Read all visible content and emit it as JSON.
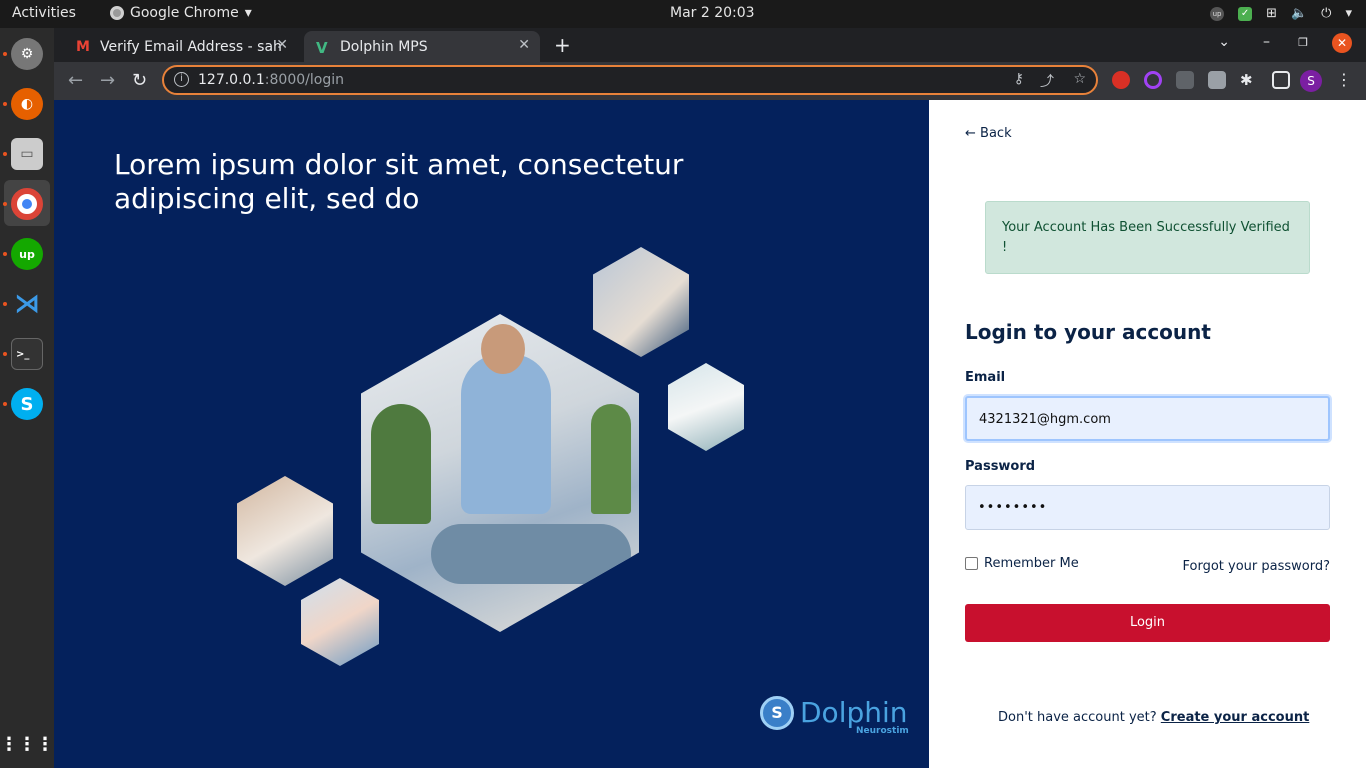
{
  "system": {
    "activities": "Activities",
    "app_name": "Google Chrome",
    "clock": "Mar 2  20:03"
  },
  "browser": {
    "tabs": [
      {
        "title": "Verify Email Address - sah",
        "favicon": "gmail-icon"
      },
      {
        "title": "Dolphin MPS",
        "favicon": "vue-icon"
      }
    ],
    "url_host": "127.0.0.1",
    "url_path": ":8000/login",
    "profile_initial": "S"
  },
  "hero": {
    "title": "Lorem ipsum dolor sit amet, consectetur adipiscing elit, sed do",
    "brand_name": "Dolphin",
    "brand_sub": "Neurostim"
  },
  "login": {
    "back_label": "Back",
    "alert_text": "Your Account Has Been Successfully Verified !",
    "title": "Login to your account",
    "email_label": "Email",
    "email_value": "4321321@hgm.com",
    "password_label": "Password",
    "password_value": "••••••••",
    "remember_label": "Remember Me",
    "forgot_label": "Forgot your password?",
    "login_button": "Login",
    "signup_prompt": "Don't have account yet?",
    "signup_link": "Create your account"
  },
  "colors": {
    "hero_bg": "#04215c",
    "primary_button": "#c8102e",
    "alert_bg": "#d1e7dd",
    "omnibox_focus": "#e8823a"
  }
}
